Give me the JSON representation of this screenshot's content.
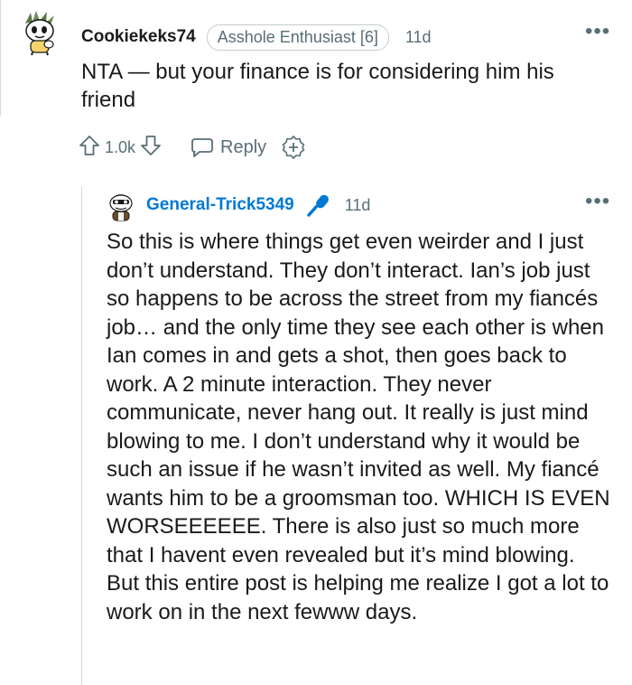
{
  "top_comment": {
    "username": "Cookiekeks74",
    "flair": "Asshole Enthusiast [6]",
    "time": "11d",
    "body": "NTA — but your finance is for considering him his friend",
    "upvotes": "1.0k",
    "reply_label": "Reply",
    "more_options": "•••"
  },
  "reply_comment": {
    "username": "General-Trick5349",
    "time": "11d",
    "body": "So this is where things get even weirder and I just don’t understand. They don’t interact. Ian’s job just so happens to be across the street from my fiancés job… and the only time they see each other is when Ian comes in and gets a shot, then goes back to work. A 2 minute interaction. They never communicate, never hang out. It really is just mind blowing to me. I don’t understand why it would be such an issue if he wasn’t invited as well. My fiancé wants him to be a groomsman too. WHICH IS EVEN WORSEEEEEE. There is also just so much more that I havent even revealed but it’s mind blowing. But this entire post is helping me realize I got a lot to work on in the next fewww days.",
    "more_options": "•••",
    "op_badge_icon": "microphone-icon"
  },
  "colors": {
    "text": "#1a1a1b",
    "meta": "#576f76",
    "op_blue": "#0079d3",
    "thread_line": "#d7dadc"
  }
}
